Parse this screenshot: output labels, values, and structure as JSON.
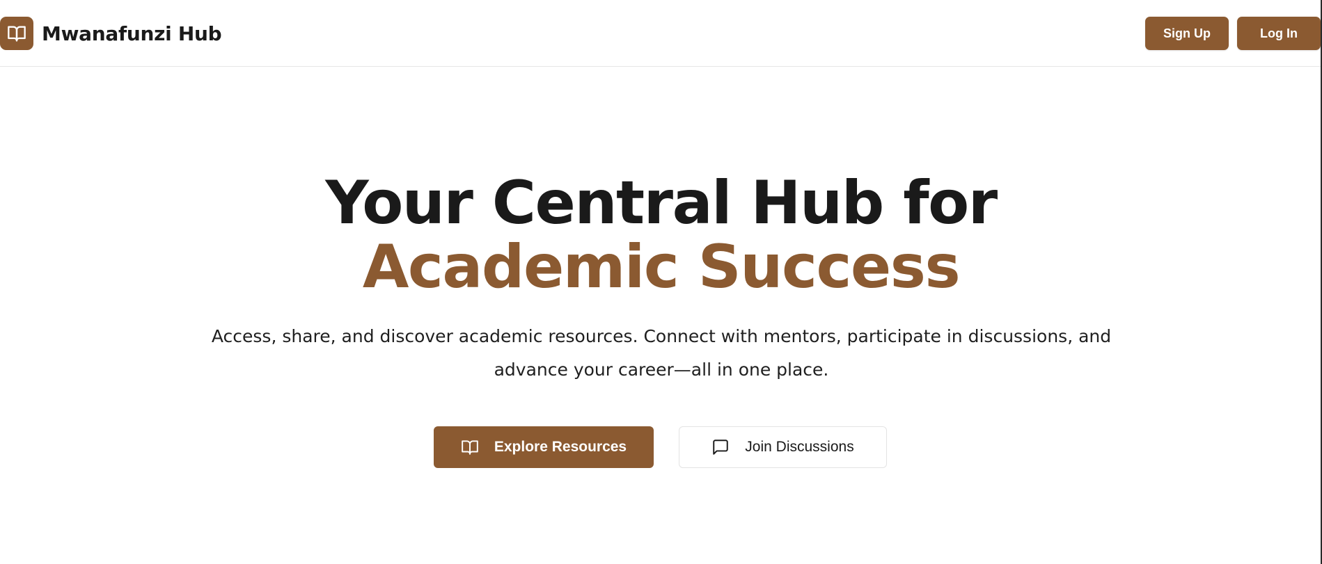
{
  "header": {
    "brand_name": "Mwanafunzi Hub",
    "logo_icon": "book-open-icon",
    "signup_label": "Sign Up",
    "login_label": "Log In"
  },
  "hero": {
    "title_line1": "Your Central Hub for",
    "title_line2": "Academic Success",
    "description": "Access, share, and discover academic resources. Connect with mentors, participate in discussions, and advance your career—all in one place.",
    "primary_cta": {
      "label": "Explore Resources",
      "icon": "book-open-icon"
    },
    "secondary_cta": {
      "label": "Join Discussions",
      "icon": "message-square-icon"
    }
  },
  "colors": {
    "brand": "#8b5a31",
    "text": "#1a1a1a",
    "background": "#ffffff",
    "border": "#e3e3e3"
  }
}
